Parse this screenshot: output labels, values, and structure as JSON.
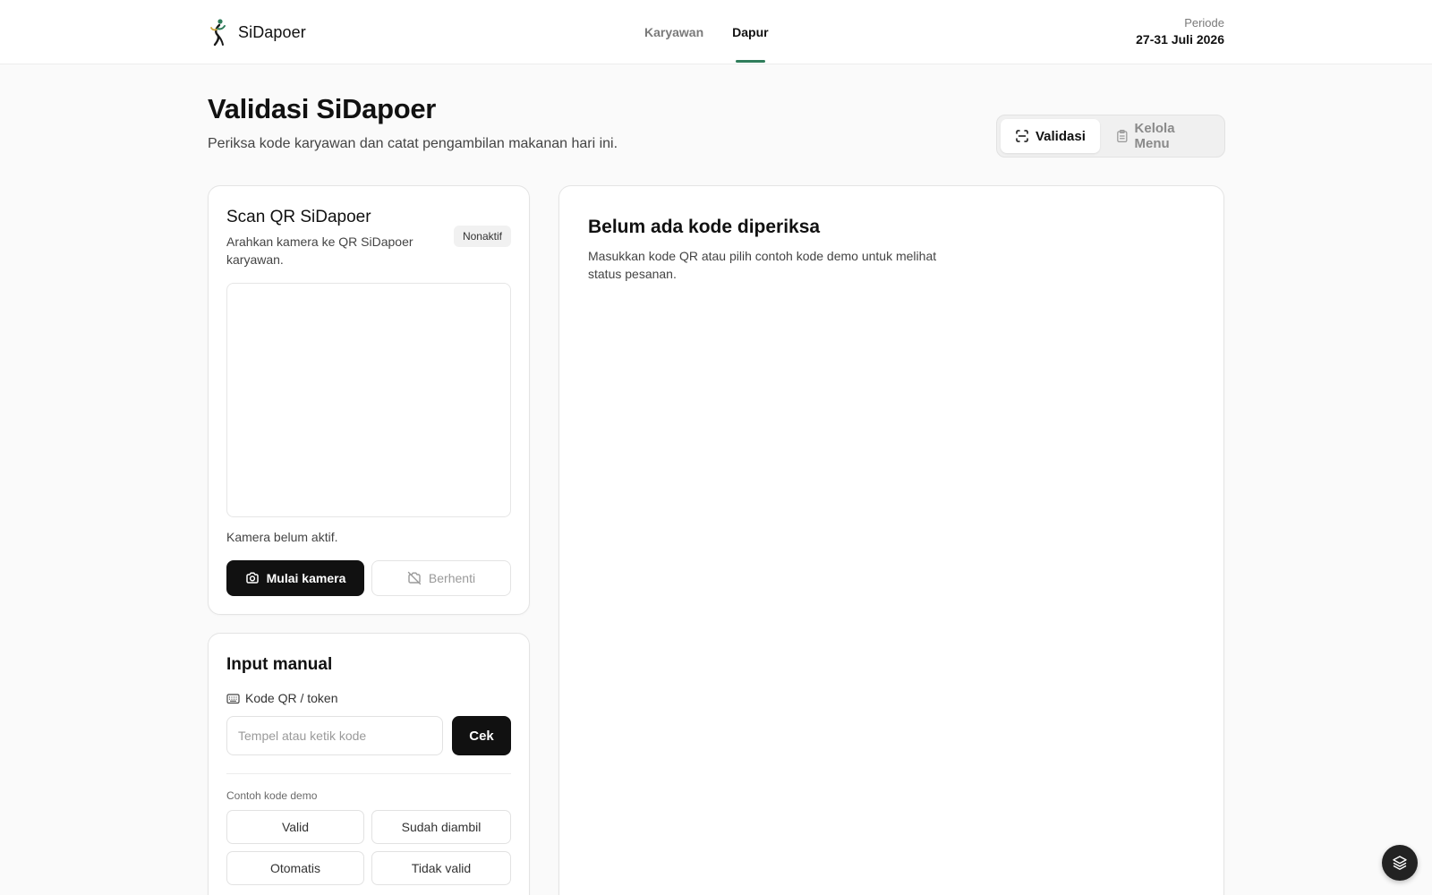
{
  "header": {
    "brand_name": "SiDapoer",
    "logo_icon": "runner-logo",
    "nav": [
      {
        "label": "Karyawan",
        "active": false
      },
      {
        "label": "Dapur",
        "active": true
      }
    ],
    "period_label": "Periode",
    "period_value": "27-31 Juli 2026",
    "accent_color": "#2f7d5b"
  },
  "page": {
    "title": "Validasi SiDapoer",
    "subtitle": "Periksa kode karyawan dan catat pengambilan makanan hari ini.",
    "mode_toggle": [
      {
        "label": "Validasi",
        "icon": "scan-icon",
        "active": true
      },
      {
        "label": "Kelola Menu",
        "icon": "clipboard-icon",
        "active": false
      }
    ]
  },
  "scan": {
    "title": "Scan QR SiDapoer",
    "description": "Arahkan kamera ke QR SiDapoer karyawan.",
    "badge": "Nonaktif",
    "camera_status": "Kamera belum aktif.",
    "start_label": "Mulai kamera",
    "stop_label": "Berhenti"
  },
  "manual": {
    "title": "Input manual",
    "code_label": "Kode QR / token",
    "input_value": "",
    "input_placeholder": "Tempel atau ketik kode",
    "check_label": "Cek",
    "demo_label": "Contoh kode demo",
    "demo_codes": [
      "Valid",
      "Sudah diambil",
      "Otomatis",
      "Tidak valid"
    ]
  },
  "result": {
    "title": "Belum ada kode diperiksa",
    "description": "Masukkan kode QR atau pilih contoh kode demo untuk melihat status pesanan."
  },
  "floating_button_icon": "layers-icon"
}
